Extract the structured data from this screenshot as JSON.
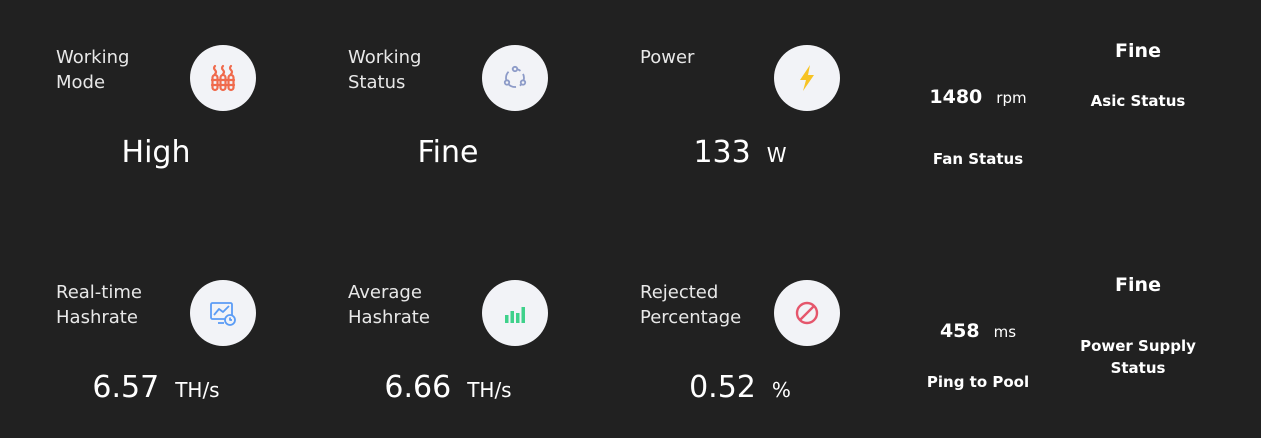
{
  "cards": {
    "working_mode": {
      "label": "Working\nMode",
      "value": "High",
      "icon": "heater-icon",
      "icon_color": "#f06a4c"
    },
    "working_status": {
      "label": "Working\nStatus",
      "value": "Fine",
      "icon": "cycle-icon",
      "icon_color": "#8d9bc8"
    },
    "power": {
      "label": "Power",
      "value": "133",
      "unit": "W",
      "icon": "lightning-icon",
      "icon_color": "#f7c324"
    },
    "realtime_hashrate": {
      "label": "Real-time\nHashrate",
      "value": "6.57",
      "unit": "TH/s",
      "icon": "monitor-chart-icon",
      "icon_color": "#5b9cf5"
    },
    "average_hashrate": {
      "label": "Average\nHashrate",
      "value": "6.66",
      "unit": "TH/s",
      "icon": "bar-chart-icon",
      "icon_color": "#3fd18b"
    },
    "rejected_percentage": {
      "label": "Rejected\nPercentage",
      "value": "0.52",
      "unit": "%",
      "icon": "prohibited-icon",
      "icon_color": "#e5566c"
    }
  },
  "fan": {
    "value": "1480",
    "unit": "rpm",
    "label": "Fan Status"
  },
  "asic": {
    "value": "Fine",
    "label": "Asic Status"
  },
  "ping": {
    "value": "458",
    "unit": "ms",
    "label": "Ping to Pool"
  },
  "psu": {
    "value": "Fine",
    "label": "Power Supply\nStatus"
  }
}
